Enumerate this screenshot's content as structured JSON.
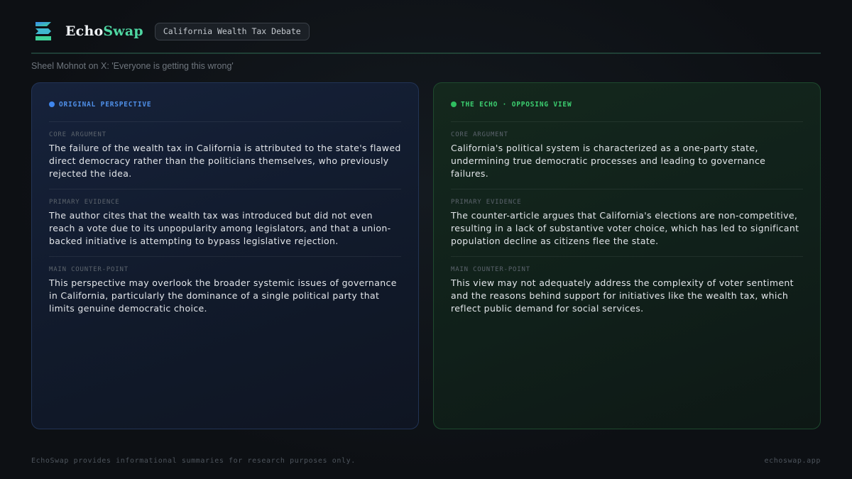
{
  "header": {
    "brand_part1": "Echo",
    "brand_part2": "Swap",
    "topic": "California Wealth Tax Debate",
    "logo_icon": "echoswap-logo-icon"
  },
  "source_line": "Sheel Mohnot on X: 'Everyone is getting this wrong'",
  "colors": {
    "brand_accent": "#4fd6a2",
    "original_accent": "#3f86ee",
    "echo_accent": "#2fbf60"
  },
  "panels": {
    "original": {
      "heading": "ORIGINAL PERSPECTIVE",
      "sections": [
        {
          "label": "CORE ARGUMENT",
          "text": "The failure of the wealth tax in California is attributed to the state's flawed direct democracy rather than the politicians themselves, who previously rejected the idea."
        },
        {
          "label": "PRIMARY EVIDENCE",
          "text": "The author cites that the wealth tax was introduced but did not even reach a vote due to its unpopularity among legislators, and that a union-backed initiative is attempting to bypass legislative rejection."
        },
        {
          "label": "MAIN COUNTER-POINT",
          "text": "This perspective may overlook the broader systemic issues of governance in California, particularly the dominance of a single political party that limits genuine democratic choice."
        }
      ]
    },
    "echo": {
      "heading": "THE ECHO · OPPOSING VIEW",
      "sections": [
        {
          "label": "CORE ARGUMENT",
          "text": "California's political system is characterized as a one-party state, undermining true democratic processes and leading to governance failures."
        },
        {
          "label": "PRIMARY EVIDENCE",
          "text": "The counter-article argues that California's elections are non-competitive, resulting in a lack of substantive voter choice, which has led to significant population decline as citizens flee the state."
        },
        {
          "label": "MAIN COUNTER-POINT",
          "text": "This view may not adequately address the complexity of voter sentiment and the reasons behind support for initiatives like the wealth tax, which reflect public demand for social services."
        }
      ]
    }
  },
  "footer": {
    "disclaimer": "EchoSwap provides informational summaries for research purposes only.",
    "site": "echoswap.app"
  }
}
